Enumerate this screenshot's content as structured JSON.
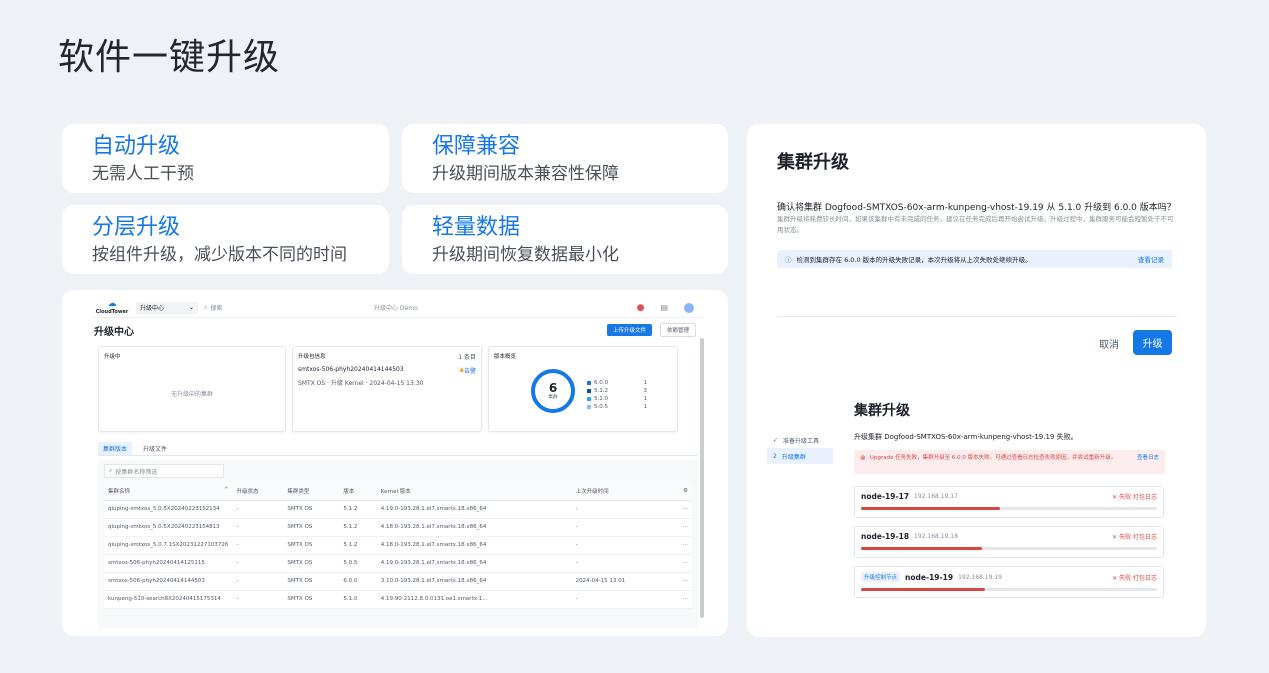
{
  "slide": {
    "title": "软件一键升级"
  },
  "features": [
    {
      "title": "自动升级",
      "desc": "无需人工干预"
    },
    {
      "title": "保障兼容",
      "desc": "升级期间版本兼容性保障"
    },
    {
      "title": "分层升级",
      "desc": "按组件升级，减少版本不同的时间"
    },
    {
      "title": "轻量数据",
      "desc": "升级期间恢复数据最小化"
    }
  ],
  "app": {
    "logo": "CloudTower",
    "selector": "升级中心",
    "search_placeholder": "搜索",
    "center_title": "升级中心 Demo",
    "page_title": "升级中心",
    "upload_button": "上传升级文件",
    "manage_button": "依赖管理",
    "cards": {
      "upgrading": {
        "title": "升级中",
        "empty": "无升级中的集群"
      },
      "package": {
        "title": "升级包信息",
        "count": "1 条目",
        "name": "smtxos-506-phyh20240414144503",
        "meta": "SMTX OS · 升级 Kernel · 2024-04-15 13:30",
        "status": "告警"
      },
      "version": {
        "title": "版本概览",
        "total": "6",
        "total_label": "集群",
        "items": [
          {
            "version": "6.0.0",
            "count": "1",
            "color": "#1677e6"
          },
          {
            "version": "5.1.2",
            "count": "3",
            "color": "#0e4ea3"
          },
          {
            "version": "5.1.0",
            "count": "1",
            "color": "#36a3f7"
          },
          {
            "version": "5.0.5",
            "count": "1",
            "color": "#7fc4f5"
          }
        ]
      }
    },
    "tabs": [
      "集群版本",
      "升级文件"
    ],
    "filter_placeholder": "按集群名称筛选",
    "table": {
      "columns": [
        "集群名称",
        "升级状态",
        "集群类型",
        "版本",
        "Kernel 版本",
        "上次升级时间"
      ],
      "rows": [
        [
          "qiuping-smtxos_5.0.5X20240223152134",
          "-",
          "SMTX OS",
          "5.1.2",
          "4.19.0-193.28.1.el7.smartx.18.x86_64",
          "-"
        ],
        [
          "qiuping-smtxos_5.0.5X20240223154813",
          "-",
          "SMTX OS",
          "5.1.2",
          "4.18.0-193.28.1.el7.smartx.18.x86_64",
          "-"
        ],
        [
          "qiuping-smtxos_5.0.7.1SX20231227103726",
          "-",
          "SMTX OS",
          "5.1.2",
          "4.18.0-193.28.1.el7.smartx.18.x86_64",
          "-"
        ],
        [
          "smtxos-506-phyh20240414125115",
          "-",
          "SMTX OS",
          "5.0.5",
          "4.19.0-193.28.1.el7.smartx.18.x86_64",
          "-"
        ],
        [
          "smtxos-506-phyh20240414144503",
          "-",
          "SMTX OS",
          "6.0.0",
          "3.10.0-193.28.1.el7.smartx.18.x86_64",
          "2024-04-15 13:01"
        ],
        [
          "kunpeng-510-search8X20240415175314",
          "-",
          "SMTX OS",
          "5.1.0",
          "4.19.90-2112.8.0.0131.oe1.smartx.1...",
          "-"
        ]
      ]
    }
  },
  "dialog": {
    "title": "集群升级",
    "question": "确认将集群 Dogfood-SMTXOS-60x-arm-kunpeng-vhost-19.19 从 5.1.0 升级到 6.0.0 版本吗？",
    "desc": "集群升级将耗费较长时间，如果该集群中有未完成的任务，建议在任务完成后再开始尝试升级。升级过程中，集群服务可能会短暂处于不可用状态。",
    "info": "检测到集群存在 6.0.0 版本的升级失败记录，本次升级将从上次失败处继续升级。",
    "info_link": "查看记录",
    "cancel": "取消",
    "confirm": "升级"
  },
  "progress": {
    "title": "集群升级",
    "steps": [
      {
        "label": "准备升级工具"
      },
      {
        "label": "升级集群"
      }
    ],
    "subtitle": "升级集群 Dogfood-SMTXOS-60x-arm-kunpeng-vhost-19.19 失败。",
    "error": "Upgrade 任务失败，集群升级至 6.0.0 版本失败。可通过查看日志检查失败原因，并尝试重新升级。",
    "error_link": "查看日志",
    "nodes": [
      {
        "name": "node-19-17",
        "ip": "192.168.19.17",
        "status": "失败 打包日志",
        "tag": "",
        "progress": 0.47
      },
      {
        "name": "node-19-18",
        "ip": "192.168.19.18",
        "status": "失败 打包日志",
        "tag": "",
        "progress": 0.41
      },
      {
        "name": "node-19-19",
        "ip": "192.168.19.19",
        "status": "失败 打包日志",
        "tag": "升级控制节点",
        "progress": 0.42
      }
    ]
  }
}
